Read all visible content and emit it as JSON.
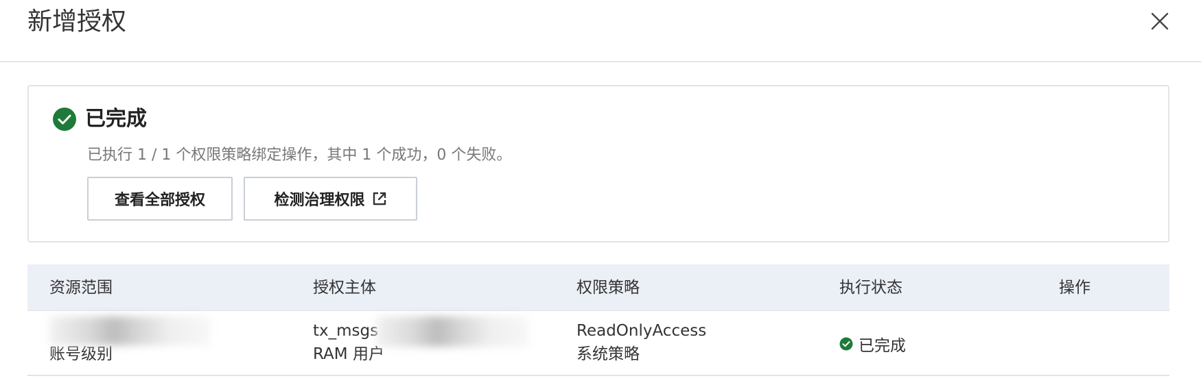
{
  "dialog": {
    "title": "新增授权",
    "close_icon": "close-icon"
  },
  "result": {
    "status_title": "已完成",
    "status_icon": "check-circle-icon",
    "description": "已执行 1 / 1 个权限策略绑定操作，其中 1 个成功，0 个失败。",
    "buttons": {
      "view_all": "查看全部授权",
      "check_governance": "检测治理权限",
      "external_link_icon": "external-link-icon"
    },
    "accent_color": "#1f7a3a"
  },
  "table": {
    "columns": [
      "资源范围",
      "授权主体",
      "权限策略",
      "执行状态",
      "操作"
    ],
    "rows": [
      {
        "resource_scope": {
          "name": "",
          "level": "账号级别"
        },
        "principal": {
          "name": "tx_msgs",
          "type": "RAM 用户"
        },
        "policy": {
          "name": "ReadOnlyAccess",
          "type": "系统策略"
        },
        "status": "已完成",
        "action": ""
      }
    ]
  }
}
